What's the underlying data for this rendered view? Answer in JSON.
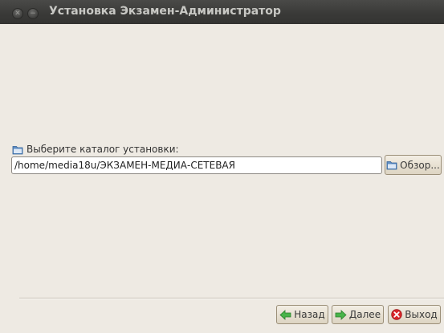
{
  "window": {
    "title": "Установка Экзамен-Администратор"
  },
  "install_dir": {
    "label": "Выберите каталог установки:",
    "path_value": "/home/media18u/ЭКЗАМЕН-МЕДИА-СЕТЕВАЯ",
    "browse_label": "Обзор..."
  },
  "footer": {
    "back_label": "Назад",
    "next_label": "Далее",
    "exit_label": "Выход"
  },
  "icons": {
    "window_controls": [
      "close-icon",
      "minimize-icon"
    ],
    "folder": "folder-icon",
    "back": "arrow-left-icon",
    "next": "arrow-right-icon",
    "exit": "close-circle-icon"
  },
  "colors": {
    "titlebar": "#3a3a38",
    "background": "#eeeae3",
    "arrow_green": "#3aa33a",
    "exit_red": "#d9262a"
  }
}
